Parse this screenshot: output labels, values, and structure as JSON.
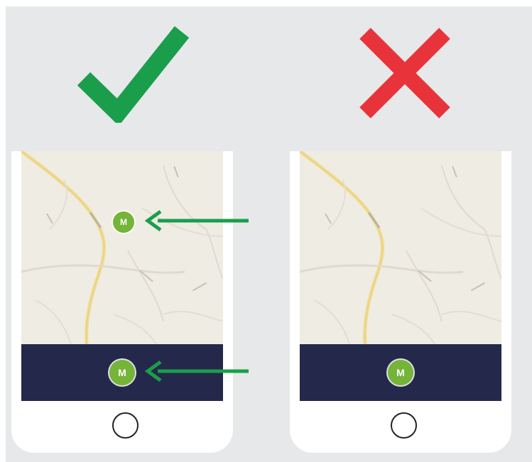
{
  "colors": {
    "background": "#e7e8ea",
    "check": "#1a9e4b",
    "cross": "#e8333b",
    "tabbar": "#24284a",
    "pin": "#74b437",
    "arrow": "#1a9e4b",
    "map": "#efece3",
    "road": "#f1dc92"
  },
  "icons": {
    "correct": "check-mark-icon",
    "incorrect": "cross-mark-icon",
    "pin": "m-logo-pin-icon",
    "arrow": "left-arrow-icon",
    "home": "home-button-icon"
  },
  "panels": {
    "correct": {
      "map_pin_label": "M",
      "tabbar_pin_label": "M"
    },
    "incorrect": {
      "tabbar_pin_label": "M"
    }
  }
}
